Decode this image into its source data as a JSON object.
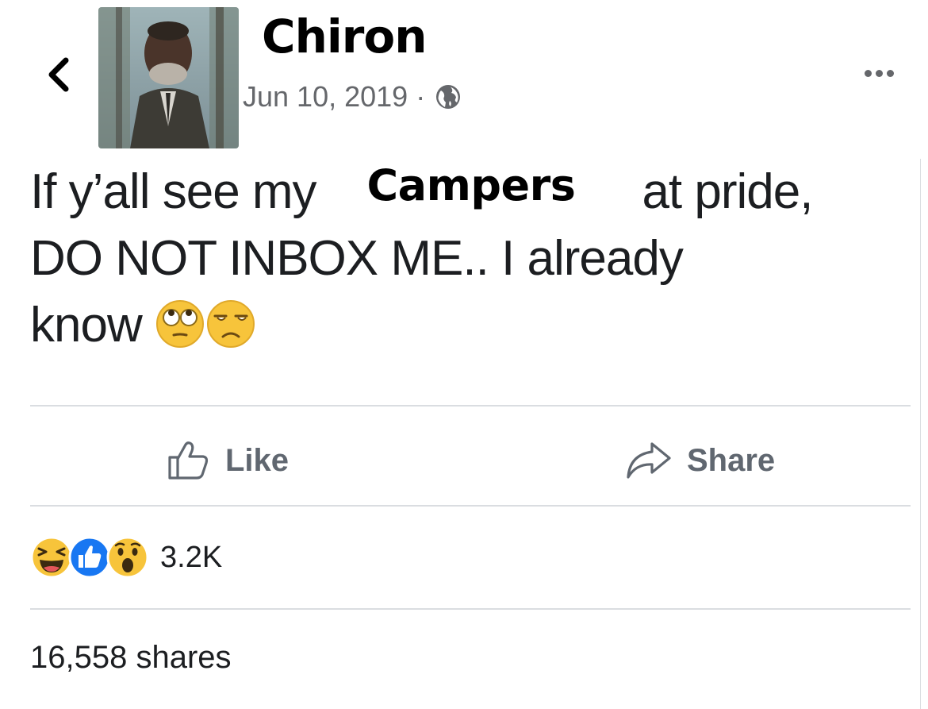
{
  "post": {
    "author_name": "Chiron",
    "date": "Jun 10, 2019",
    "separator": "·",
    "audience_icon": "globe-icon",
    "text_line1_before": "If y’all see my",
    "highlight_word": "Campers",
    "text_line1_after": "at pride,",
    "text_line2": "DO NOT INBOX ME.. I already",
    "text_line3": "know",
    "emojis": [
      "face-with-rolling-eyes-emoji",
      "unamused-face-emoji"
    ]
  },
  "actions": {
    "like_label": "Like",
    "share_label": "Share"
  },
  "reactions": {
    "icons": [
      "laughing-reaction-icon",
      "like-reaction-icon",
      "wow-reaction-icon"
    ],
    "count": "3.2K"
  },
  "shares": {
    "label": "16,558 shares"
  },
  "colors": {
    "text": "#1c1e21",
    "secondary_text": "#65676b",
    "divider": "#dadde1",
    "like_blue": "#1877f2",
    "emoji_yellow": "#f7c43b"
  }
}
